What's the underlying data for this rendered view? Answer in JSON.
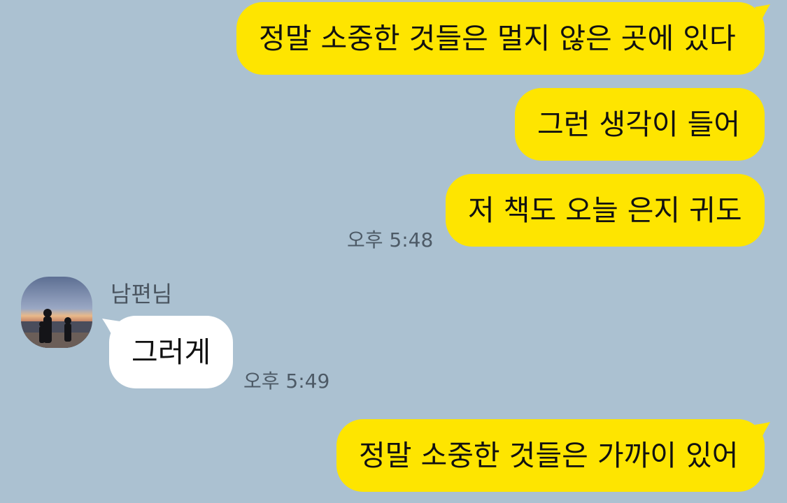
{
  "messages": [
    {
      "side": "me",
      "text": "정말 소중한 것들은 멀지 않은 곳에 있다"
    },
    {
      "side": "me",
      "text": "그런 생각이 들어"
    },
    {
      "side": "me",
      "text": "저 책도 오늘 은지 귀도",
      "time": "오후 5:48"
    },
    {
      "side": "other",
      "sender": "남편님",
      "text": "그러게",
      "time": "오후 5:49"
    },
    {
      "side": "me",
      "text": "정말 소중한 것들은 가까이 있어"
    }
  ],
  "colors": {
    "background": "#abc1d1",
    "my_bubble": "#fee500",
    "other_bubble": "#ffffff"
  }
}
